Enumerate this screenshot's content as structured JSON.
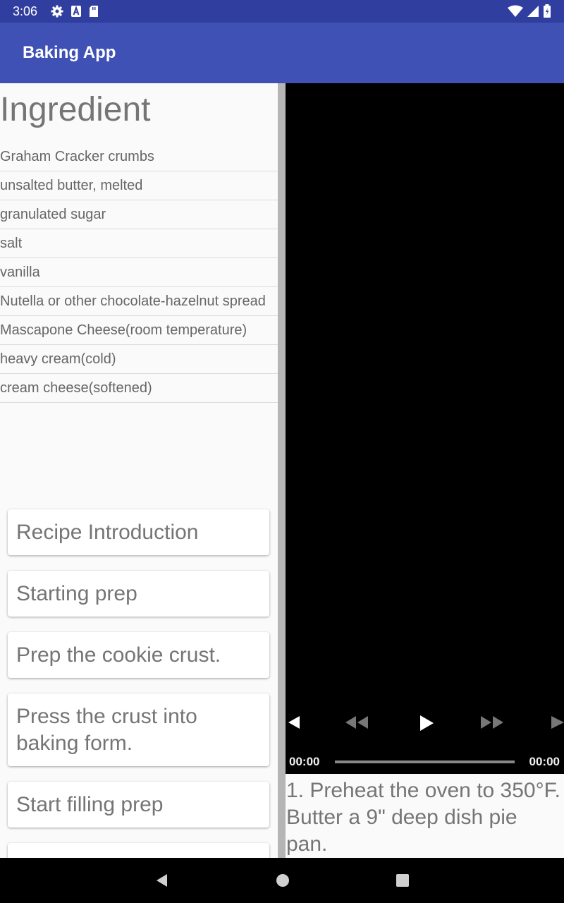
{
  "status_bar": {
    "time": "3:06",
    "left_icons": [
      "gear-icon",
      "a-icon",
      "sd-card-icon"
    ],
    "right_icons": [
      "wifi-icon",
      "signal-icon",
      "battery-icon"
    ]
  },
  "app_bar": {
    "title": "Baking App"
  },
  "ingredients": {
    "heading": "Ingredient",
    "items": [
      "Graham Cracker crumbs",
      "unsalted butter, melted",
      "granulated sugar",
      "salt",
      "vanilla",
      "Nutella or other chocolate-hazelnut spread",
      "Mascapone Cheese(room temperature)",
      "heavy cream(cold)",
      "cream cheese(softened)"
    ]
  },
  "steps": [
    {
      "label": "Recipe Introduction"
    },
    {
      "label": "Starting prep"
    },
    {
      "label": "Prep the cookie crust."
    },
    {
      "label": "Press the crust into baking form."
    },
    {
      "label": "Start filling prep"
    }
  ],
  "player": {
    "position": "00:00",
    "duration": "00:00",
    "progress": 0,
    "controls": [
      "previous-icon",
      "rewind-icon",
      "play-icon",
      "fast-forward-icon",
      "next-icon"
    ]
  },
  "step_description": "1. Preheat the oven to 350°F. Butter a 9\" deep dish pie pan.",
  "nav_bar": {
    "buttons": [
      "back-icon",
      "home-icon",
      "recents-icon"
    ]
  },
  "colors": {
    "primary": "#3f51b5",
    "primary_dark": "#303f9f",
    "text_secondary": "#757575"
  }
}
